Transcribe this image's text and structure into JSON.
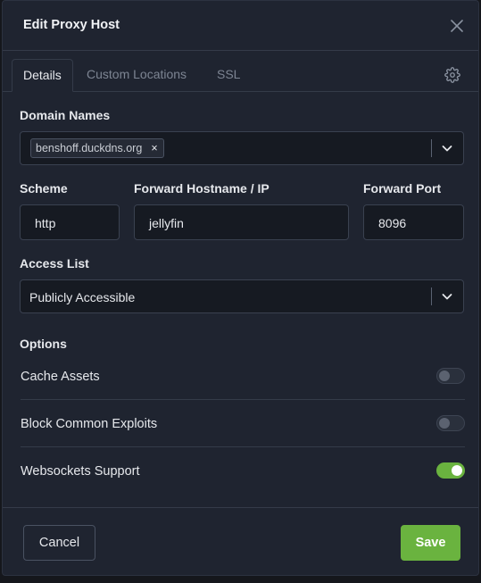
{
  "modal": {
    "title": "Edit Proxy Host"
  },
  "tabs": [
    {
      "label": "Details",
      "active": true
    },
    {
      "label": "Custom Locations",
      "active": false
    },
    {
      "label": "SSL",
      "active": false
    }
  ],
  "domain_names": {
    "label": "Domain Names",
    "chips": [
      "benshoff.duckdns.org"
    ]
  },
  "scheme": {
    "label": "Scheme",
    "value": "http"
  },
  "forward_hostname": {
    "label": "Forward Hostname / IP",
    "value": "jellyfin"
  },
  "forward_port": {
    "label": "Forward Port",
    "value": "8096"
  },
  "access_list": {
    "label": "Access List",
    "value": "Publicly Accessible"
  },
  "options": {
    "heading": "Options",
    "items": [
      {
        "label": "Cache Assets",
        "enabled": false
      },
      {
        "label": "Block Common Exploits",
        "enabled": false
      },
      {
        "label": "Websockets Support",
        "enabled": true
      }
    ]
  },
  "footer": {
    "cancel_label": "Cancel",
    "save_label": "Save"
  },
  "colors": {
    "accent": "#6ab33f",
    "background": "#1f2430",
    "input_bg": "#161a22"
  },
  "icons": {
    "close": "close-icon",
    "settings": "gear-icon",
    "dropdown": "chevron-down-icon",
    "remove_chip": "x-icon"
  }
}
